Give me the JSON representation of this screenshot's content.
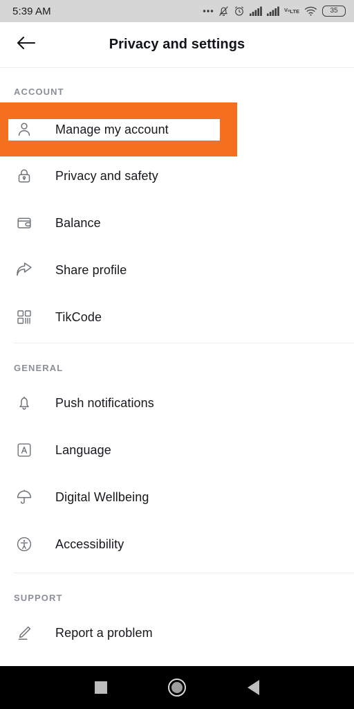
{
  "status_bar": {
    "time": "5:39 AM",
    "battery_level": "35",
    "network_label": "VoLTE",
    "icons": [
      "more-dots-icon",
      "bell-muted-icon",
      "alarm-clock-icon",
      "signal-bars-icon",
      "signal-bars-icon",
      "volte-icon",
      "wifi-icon",
      "battery-icon"
    ]
  },
  "header": {
    "title": "Privacy and settings",
    "back_icon": "arrow-left-icon"
  },
  "highlight": {
    "color": "#f4701f",
    "target_label": "Manage my account"
  },
  "sections": [
    {
      "label": "ACCOUNT",
      "items": [
        {
          "label": "Manage my account",
          "icon": "person-icon",
          "highlighted": true
        },
        {
          "label": "Privacy and safety",
          "icon": "lock-icon",
          "highlighted": false
        },
        {
          "label": "Balance",
          "icon": "wallet-icon",
          "highlighted": false
        },
        {
          "label": "Share profile",
          "icon": "share-arrow-icon",
          "highlighted": false
        },
        {
          "label": "TikCode",
          "icon": "qr-code-icon",
          "highlighted": false
        }
      ]
    },
    {
      "label": "GENERAL",
      "items": [
        {
          "label": "Push notifications",
          "icon": "bell-icon",
          "highlighted": false
        },
        {
          "label": "Language",
          "icon": "language-a-icon",
          "highlighted": false
        },
        {
          "label": "Digital Wellbeing",
          "icon": "umbrella-icon",
          "highlighted": false
        },
        {
          "label": "Accessibility",
          "icon": "accessibility-icon",
          "highlighted": false
        }
      ]
    },
    {
      "label": "SUPPORT",
      "items": [
        {
          "label": "Report a problem",
          "icon": "pencil-icon",
          "highlighted": false
        }
      ]
    }
  ],
  "nav_bar": {
    "recents": "square-recents-icon",
    "home": "circle-home-icon",
    "back": "triangle-back-icon"
  }
}
